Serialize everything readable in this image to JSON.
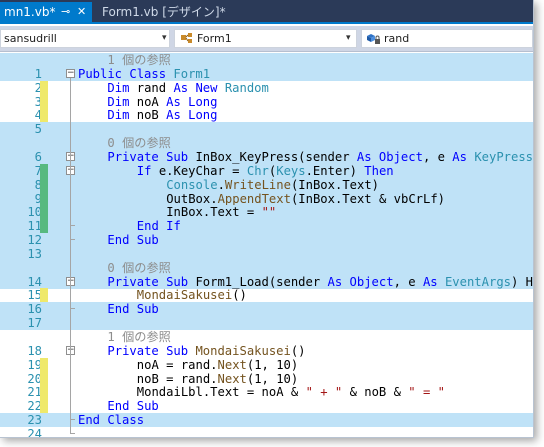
{
  "tabs": {
    "active_label": "mn1.vb*",
    "pin": "⊸",
    "close": "✕",
    "other_label": "Form1.vb [デザイン]*"
  },
  "navbar": {
    "project": "sansudrill",
    "class": "Form1",
    "member": "rand",
    "chevron": "▾"
  },
  "lines": [
    {
      "n": "",
      "hl": true,
      "mark": "",
      "fold": "",
      "segs": [
        {
          "t": "1 個の参照",
          "c": "ref"
        }
      ],
      "indent": 1
    },
    {
      "n": "1",
      "hl": true,
      "mark": "",
      "fold": "−",
      "segs": [
        {
          "t": "Public Class ",
          "c": "kw"
        },
        {
          "t": "Form1",
          "c": "ty"
        }
      ],
      "indent": 0
    },
    {
      "n": "2",
      "hl": false,
      "mark": "y",
      "fold": "",
      "segs": [
        {
          "t": "Dim ",
          "c": "kw"
        },
        {
          "t": "rand ",
          "c": ""
        },
        {
          "t": "As New ",
          "c": "kw"
        },
        {
          "t": "Random",
          "c": "ty"
        }
      ],
      "indent": 1
    },
    {
      "n": "3",
      "hl": false,
      "mark": "y",
      "fold": "",
      "segs": [
        {
          "t": "Dim ",
          "c": "kw"
        },
        {
          "t": "noA ",
          "c": ""
        },
        {
          "t": "As Long",
          "c": "kw"
        }
      ],
      "indent": 1
    },
    {
      "n": "4",
      "hl": false,
      "mark": "y",
      "fold": "",
      "segs": [
        {
          "t": "Dim ",
          "c": "kw"
        },
        {
          "t": "noB ",
          "c": ""
        },
        {
          "t": "As Long",
          "c": "kw"
        }
      ],
      "indent": 1
    },
    {
      "n": "5",
      "hl": true,
      "mark": "",
      "fold": "",
      "segs": [],
      "indent": 0
    },
    {
      "n": "",
      "hl": true,
      "mark": "",
      "fold": "",
      "segs": [
        {
          "t": "0 個の参照",
          "c": "ref"
        }
      ],
      "indent": 1
    },
    {
      "n": "6",
      "hl": true,
      "mark": "",
      "fold": "−",
      "segs": [
        {
          "t": "Private Sub ",
          "c": "kw"
        },
        {
          "t": "InBox_KeyPress(sender ",
          "c": ""
        },
        {
          "t": "As Object",
          "c": "kw"
        },
        {
          "t": ", e ",
          "c": ""
        },
        {
          "t": "As ",
          "c": "kw"
        },
        {
          "t": "KeyPressEve",
          "c": "ty"
        }
      ],
      "indent": 1
    },
    {
      "n": "7",
      "hl": true,
      "mark": "g",
      "fold": "−",
      "segs": [
        {
          "t": "If ",
          "c": "kw"
        },
        {
          "t": "e.KeyChar = ",
          "c": ""
        },
        {
          "t": "Chr",
          "c": "ty"
        },
        {
          "t": "(",
          "c": ""
        },
        {
          "t": "Keys",
          "c": "ty"
        },
        {
          "t": ".Enter) ",
          "c": ""
        },
        {
          "t": "Then",
          "c": "kw"
        }
      ],
      "indent": 2
    },
    {
      "n": "8",
      "hl": true,
      "mark": "g",
      "fold": "",
      "segs": [
        {
          "t": "Console",
          "c": "ty"
        },
        {
          "t": ".",
          "c": ""
        },
        {
          "t": "WriteLine",
          "c": "mt"
        },
        {
          "t": "(InBox.Text)",
          "c": ""
        }
      ],
      "indent": 3
    },
    {
      "n": "9",
      "hl": true,
      "mark": "g",
      "fold": "",
      "segs": [
        {
          "t": "OutBox.",
          "c": ""
        },
        {
          "t": "AppendText",
          "c": "mt"
        },
        {
          "t": "(InBox.Text & vbCrLf)",
          "c": ""
        }
      ],
      "indent": 3
    },
    {
      "n": "10",
      "hl": true,
      "mark": "g",
      "fold": "",
      "segs": [
        {
          "t": "InBox.Text = ",
          "c": ""
        },
        {
          "t": "\"\"",
          "c": "st"
        }
      ],
      "indent": 3
    },
    {
      "n": "11",
      "hl": true,
      "mark": "g",
      "fold": "",
      "segs": [
        {
          "t": "End If",
          "c": "kw"
        }
      ],
      "indent": 2
    },
    {
      "n": "12",
      "hl": true,
      "mark": "",
      "fold": "",
      "segs": [
        {
          "t": "End Sub",
          "c": "kw"
        }
      ],
      "indent": 1
    },
    {
      "n": "13",
      "hl": true,
      "mark": "",
      "fold": "",
      "segs": [],
      "indent": 0
    },
    {
      "n": "",
      "hl": true,
      "mark": "",
      "fold": "",
      "segs": [
        {
          "t": "0 個の参照",
          "c": "ref"
        }
      ],
      "indent": 1
    },
    {
      "n": "14",
      "hl": true,
      "mark": "",
      "fold": "−",
      "segs": [
        {
          "t": "Private Sub ",
          "c": "kw"
        },
        {
          "t": "Form1_Load(sender ",
          "c": ""
        },
        {
          "t": "As Object",
          "c": "kw"
        },
        {
          "t": ", e ",
          "c": ""
        },
        {
          "t": "As ",
          "c": "kw"
        },
        {
          "t": "EventArgs",
          "c": "ty"
        },
        {
          "t": ") Hand",
          "c": ""
        }
      ],
      "indent": 1
    },
    {
      "n": "15",
      "hl": false,
      "mark": "y",
      "fold": "",
      "segs": [
        {
          "t": "MondaiSakusei",
          "c": "mt"
        },
        {
          "t": "()",
          "c": ""
        }
      ],
      "indent": 2
    },
    {
      "n": "16",
      "hl": true,
      "mark": "",
      "fold": "",
      "segs": [
        {
          "t": "End Sub",
          "c": "kw"
        }
      ],
      "indent": 1
    },
    {
      "n": "17",
      "hl": true,
      "mark": "",
      "fold": "",
      "segs": [],
      "indent": 0
    },
    {
      "n": "",
      "hl": false,
      "mark": "",
      "fold": "",
      "segs": [
        {
          "t": "1 個の参照",
          "c": "ref"
        }
      ],
      "indent": 1
    },
    {
      "n": "18",
      "hl": false,
      "mark": "",
      "fold": "−",
      "segs": [
        {
          "t": "Private Sub ",
          "c": "kw"
        },
        {
          "t": "MondaiSakusei",
          "c": "mt"
        },
        {
          "t": "()",
          "c": ""
        }
      ],
      "indent": 1
    },
    {
      "n": "19",
      "hl": false,
      "mark": "y",
      "fold": "",
      "segs": [
        {
          "t": "noA = rand.",
          "c": ""
        },
        {
          "t": "Next",
          "c": "mt"
        },
        {
          "t": "(1, 10)",
          "c": ""
        }
      ],
      "indent": 2
    },
    {
      "n": "20",
      "hl": false,
      "mark": "y",
      "fold": "",
      "segs": [
        {
          "t": "noB = rand.",
          "c": ""
        },
        {
          "t": "Next",
          "c": "mt"
        },
        {
          "t": "(1, 10)",
          "c": ""
        }
      ],
      "indent": 2
    },
    {
      "n": "21",
      "hl": false,
      "mark": "y",
      "fold": "",
      "segs": [
        {
          "t": "MondaiLbl.Text = noA & ",
          "c": ""
        },
        {
          "t": "\" + \"",
          "c": "st"
        },
        {
          "t": " & noB & ",
          "c": ""
        },
        {
          "t": "\" = \"",
          "c": "st"
        }
      ],
      "indent": 2
    },
    {
      "n": "22",
      "hl": false,
      "mark": "y",
      "fold": "",
      "segs": [
        {
          "t": "End Sub",
          "c": "kw"
        }
      ],
      "indent": 1
    },
    {
      "n": "23",
      "hl": true,
      "mark": "",
      "fold": "",
      "segs": [
        {
          "t": "End Class",
          "c": "kw"
        }
      ],
      "indent": 0
    },
    {
      "n": "24",
      "hl": false,
      "mark": "",
      "fold": "",
      "segs": [],
      "indent": 0
    }
  ],
  "colors": {
    "keyword": "#0000ff",
    "type": "#2b91af",
    "string": "#a31515",
    "method": "#74531f",
    "highlight": "#bfe2f7",
    "mark_saved": "#57b97f",
    "mark_unsaved": "#efe96b"
  }
}
